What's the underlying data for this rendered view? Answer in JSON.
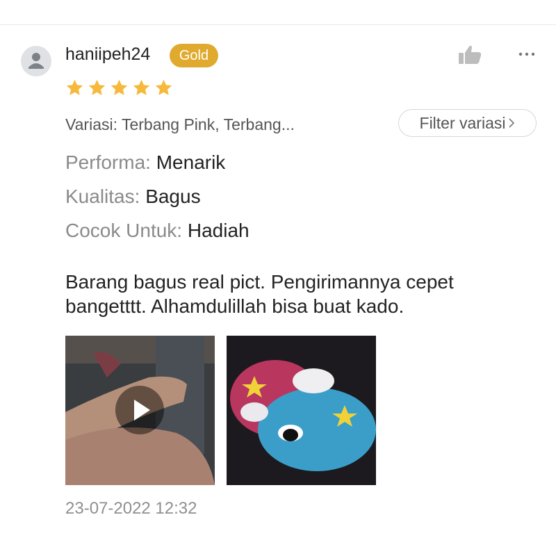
{
  "review": {
    "username": "haniipeh24",
    "badge": "Gold",
    "rating": 5,
    "variation": "Variasi: Terbang Pink, Terbang...",
    "filter_label": "Filter variasi",
    "attributes": [
      {
        "key": "Performa:",
        "value": "Menarik"
      },
      {
        "key": "Kualitas:",
        "value": "Bagus"
      },
      {
        "key": "Cocok Untuk:",
        "value": "Hadiah"
      }
    ],
    "text": "Barang bagus real pict. Pengirimannya cepet bangetttt. Alhamdulillah bisa buat kado.",
    "timestamp": "23-07-2022 12:32"
  },
  "colors": {
    "badge": "#e0aa2e",
    "star": "#f6b93b",
    "muted_text": "#8a8a8a"
  },
  "icons": {
    "avatar": "person-icon",
    "like": "thumbs-up-icon",
    "more": "more-icon",
    "filter_chevron": "chevron-right-icon",
    "play": "play-icon"
  },
  "media": [
    {
      "type": "video",
      "description_icon": "play-icon"
    },
    {
      "type": "image"
    }
  ]
}
